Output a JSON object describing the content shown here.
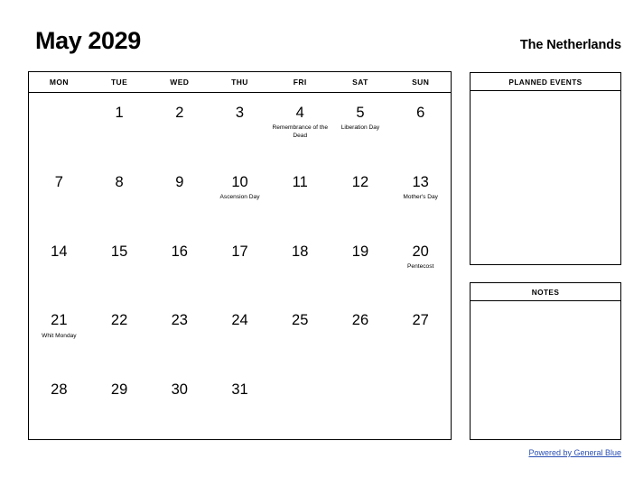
{
  "header": {
    "month_title": "May 2029",
    "country": "The Netherlands"
  },
  "calendar": {
    "weekday_headers": [
      "MON",
      "TUE",
      "WED",
      "THU",
      "FRI",
      "SAT",
      "SUN"
    ],
    "weeks": [
      [
        {
          "day": "",
          "event": ""
        },
        {
          "day": "1",
          "event": ""
        },
        {
          "day": "2",
          "event": ""
        },
        {
          "day": "3",
          "event": ""
        },
        {
          "day": "4",
          "event": "Remembrance of the Dead"
        },
        {
          "day": "5",
          "event": "Liberation Day"
        },
        {
          "day": "6",
          "event": ""
        }
      ],
      [
        {
          "day": "7",
          "event": ""
        },
        {
          "day": "8",
          "event": ""
        },
        {
          "day": "9",
          "event": ""
        },
        {
          "day": "10",
          "event": "Ascension Day"
        },
        {
          "day": "11",
          "event": ""
        },
        {
          "day": "12",
          "event": ""
        },
        {
          "day": "13",
          "event": "Mother's Day"
        }
      ],
      [
        {
          "day": "14",
          "event": ""
        },
        {
          "day": "15",
          "event": ""
        },
        {
          "day": "16",
          "event": ""
        },
        {
          "day": "17",
          "event": ""
        },
        {
          "day": "18",
          "event": ""
        },
        {
          "day": "19",
          "event": ""
        },
        {
          "day": "20",
          "event": "Pentecost"
        }
      ],
      [
        {
          "day": "21",
          "event": "Whit Monday"
        },
        {
          "day": "22",
          "event": ""
        },
        {
          "day": "23",
          "event": ""
        },
        {
          "day": "24",
          "event": ""
        },
        {
          "day": "25",
          "event": ""
        },
        {
          "day": "26",
          "event": ""
        },
        {
          "day": "27",
          "event": ""
        }
      ],
      [
        {
          "day": "28",
          "event": ""
        },
        {
          "day": "29",
          "event": ""
        },
        {
          "day": "30",
          "event": ""
        },
        {
          "day": "31",
          "event": ""
        },
        {
          "day": "",
          "event": ""
        },
        {
          "day": "",
          "event": ""
        },
        {
          "day": "",
          "event": ""
        }
      ]
    ]
  },
  "side_panels": [
    {
      "title": "PLANNED EVENTS",
      "content": ""
    },
    {
      "title": "NOTES",
      "content": ""
    }
  ],
  "footer": {
    "link_text": "Powered by General Blue",
    "link_color": "#2b50b4"
  }
}
